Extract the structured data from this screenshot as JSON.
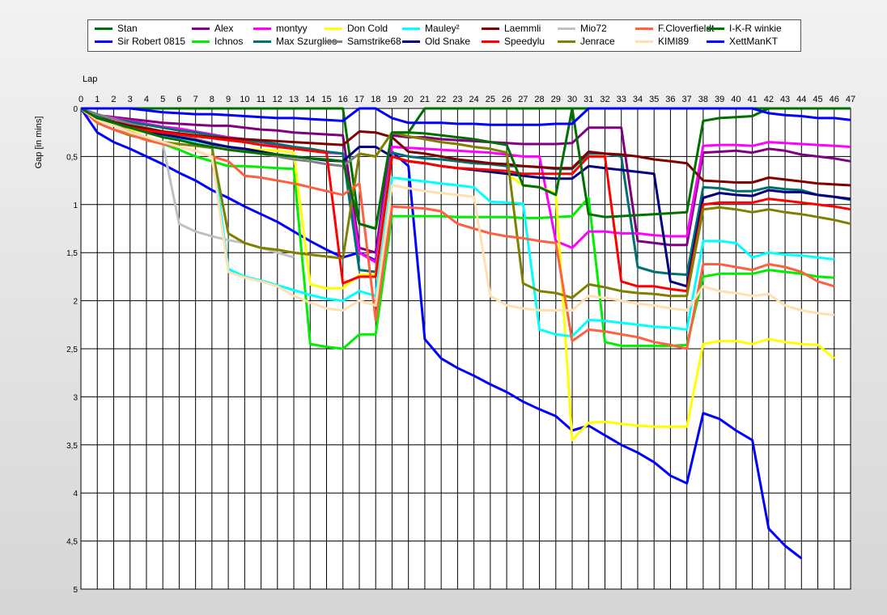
{
  "chart_data": {
    "type": "line",
    "xlabel": "Lap",
    "ylabel": "Gap [in mins]",
    "xlim": [
      0,
      47
    ],
    "ylim": [
      0,
      5
    ],
    "x_ticks": [
      0,
      1,
      2,
      3,
      4,
      5,
      6,
      7,
      8,
      9,
      10,
      11,
      12,
      13,
      14,
      15,
      16,
      17,
      18,
      19,
      20,
      21,
      22,
      23,
      24,
      25,
      26,
      27,
      28,
      29,
      30,
      31,
      32,
      33,
      34,
      35,
      36,
      37,
      38,
      39,
      40,
      41,
      42,
      43,
      44,
      45,
      46,
      47
    ],
    "y_ticks": [
      0,
      0.5,
      1,
      1.5,
      2,
      2.5,
      3,
      3.5,
      4,
      4.5,
      5
    ],
    "y_tick_labels": [
      "0",
      "0,5",
      "1",
      "1,5",
      "2",
      "2,5",
      "3",
      "3,5",
      "4",
      "4,5",
      "5"
    ],
    "grid": true,
    "legend_position": "top",
    "series": [
      {
        "name": "Stan",
        "color": "#007000",
        "values": [
          0,
          0,
          0,
          0,
          0,
          0,
          0,
          0,
          0,
          0,
          0,
          0,
          0,
          0,
          0,
          0,
          0,
          1.2,
          1.25,
          0.25,
          0.25,
          0,
          0,
          0,
          0,
          0,
          0,
          0,
          0,
          0,
          0,
          0,
          0,
          0,
          0,
          0,
          0,
          0,
          0,
          0,
          0,
          0,
          0,
          0,
          0,
          0,
          0,
          0
        ]
      },
      {
        "name": "Sir Robert 0815",
        "color": "#0000ff",
        "values": [
          0,
          0.25,
          0.35,
          0.42,
          0.5,
          0.58,
          0.67,
          0.75,
          0.85,
          0.93,
          1.02,
          1.1,
          1.18,
          1.28,
          1.38,
          1.47,
          1.55,
          1.5,
          1.58,
          0.45,
          0.6,
          2.4,
          2.6,
          2.7,
          2.78,
          2.87,
          2.95,
          3.05,
          3.13,
          3.2,
          3.35,
          3.3,
          3.4,
          3.5,
          3.58,
          3.68,
          3.82,
          3.9,
          3.17,
          3.23,
          3.35,
          3.45,
          4.37,
          4.55,
          4.68,
          null,
          null,
          null
        ]
      },
      {
        "name": "Alex",
        "color": "#800080",
        "values": [
          0,
          0.07,
          0.09,
          0.11,
          0.13,
          0.15,
          0.16,
          0.17,
          0.18,
          0.18,
          0.2,
          0.22,
          0.23,
          0.25,
          0.26,
          0.27,
          0.28,
          1.45,
          1.5,
          0.28,
          0.3,
          0.3,
          0.32,
          0.33,
          0.34,
          0.35,
          0.36,
          0.37,
          0.37,
          0.37,
          0.36,
          0.2,
          0.2,
          0.2,
          1.38,
          1.4,
          1.42,
          1.42,
          0.46,
          0.45,
          0.44,
          0.46,
          0.42,
          0.44,
          0.48,
          0.5,
          0.52,
          0.55
        ]
      },
      {
        "name": "Ichnos",
        "color": "#00ee00",
        "values": [
          0,
          0.1,
          0.18,
          0.25,
          0.32,
          0.37,
          0.43,
          0.5,
          0.55,
          0.6,
          0.6,
          0.61,
          0.62,
          0.63,
          2.45,
          2.48,
          2.5,
          2.35,
          2.35,
          1.12,
          1.12,
          1.12,
          1.12,
          1.13,
          1.13,
          1.13,
          1.13,
          1.14,
          1.14,
          1.13,
          1.12,
          0.93,
          2.43,
          2.47,
          2.47,
          2.47,
          2.47,
          2.46,
          1.75,
          1.72,
          1.72,
          1.72,
          1.68,
          1.7,
          1.72,
          1.75,
          1.76,
          null
        ]
      },
      {
        "name": "montyy",
        "color": "#ff00ff",
        "values": [
          0,
          0.07,
          0.1,
          0.13,
          0.16,
          0.19,
          0.21,
          0.24,
          0.27,
          0.3,
          0.32,
          0.35,
          0.38,
          0.41,
          0.44,
          0.46,
          0.47,
          1.5,
          1.6,
          0.4,
          0.41,
          0.42,
          0.43,
          0.44,
          0.45,
          0.46,
          0.48,
          0.5,
          0.5,
          1.38,
          1.45,
          1.28,
          1.28,
          1.3,
          1.3,
          1.32,
          1.33,
          1.33,
          0.39,
          0.38,
          0.38,
          0.39,
          0.35,
          0.36,
          0.37,
          0.38,
          0.39,
          0.4
        ]
      },
      {
        "name": "Max Szurglies",
        "color": "#007070",
        "values": [
          0,
          0.08,
          0.11,
          0.14,
          0.17,
          0.2,
          0.23,
          0.25,
          0.28,
          0.31,
          0.33,
          0.35,
          0.37,
          0.4,
          0.42,
          0.45,
          0.47,
          1.68,
          1.7,
          0.46,
          0.5,
          0.52,
          0.53,
          0.55,
          0.57,
          0.58,
          0.6,
          0.6,
          0.61,
          0.63,
          0.63,
          0.47,
          0.47,
          0.5,
          1.65,
          1.7,
          1.72,
          1.73,
          0.82,
          0.83,
          0.86,
          0.86,
          0.82,
          0.84,
          0.85,
          0.9,
          0.92,
          0.95
        ]
      },
      {
        "name": "Don Cold",
        "color": "#ffff00",
        "values": [
          0,
          0.12,
          0.18,
          0.22,
          0.25,
          0.28,
          0.31,
          0.34,
          0.37,
          0.4,
          0.42,
          0.43,
          0.44,
          0.46,
          1.83,
          1.87,
          1.87,
          1.73,
          1.73,
          0.5,
          0.55,
          0.57,
          0.6,
          0.62,
          0.64,
          0.66,
          0.68,
          0.8,
          0.82,
          0.88,
          3.45,
          3.27,
          3.26,
          3.28,
          3.3,
          3.31,
          3.31,
          3.31,
          2.45,
          2.42,
          2.42,
          2.45,
          2.4,
          2.43,
          2.45,
          2.46,
          2.6,
          null
        ]
      },
      {
        "name": "Samstrike68",
        "color": "#808080",
        "values": [
          0,
          0.06,
          0.11,
          0.16,
          0.2,
          0.24,
          0.28,
          0.32,
          0.36,
          0.4,
          0.44,
          0.47,
          0.5,
          0.53,
          0.55,
          0.58,
          0.6,
          0.47,
          0.5,
          null,
          null,
          null,
          null,
          null,
          null,
          null,
          null,
          null,
          null,
          null,
          null,
          null,
          null,
          null,
          null,
          null,
          null,
          null,
          null,
          null,
          null,
          null,
          null,
          null,
          null,
          null,
          null,
          null
        ]
      },
      {
        "name": "Mauley²",
        "color": "#00ffff",
        "values": [
          0,
          0.1,
          0.15,
          0.2,
          0.24,
          0.28,
          0.31,
          0.34,
          0.37,
          1.67,
          1.75,
          1.79,
          1.84,
          1.89,
          1.94,
          1.98,
          2.0,
          1.9,
          1.95,
          0.72,
          0.74,
          0.76,
          0.78,
          0.8,
          0.82,
          0.97,
          0.98,
          0.99,
          2.3,
          2.35,
          2.37,
          2.2,
          2.21,
          2.23,
          2.25,
          2.27,
          2.28,
          2.3,
          1.38,
          1.38,
          1.4,
          1.55,
          1.5,
          1.52,
          1.53,
          1.55,
          1.57,
          null
        ]
      },
      {
        "name": "Old Snake",
        "color": "#000080",
        "values": [
          0,
          0.1,
          0.16,
          0.2,
          0.24,
          0.27,
          0.3,
          0.33,
          0.37,
          0.4,
          0.42,
          0.45,
          0.48,
          0.5,
          0.52,
          0.54,
          0.55,
          0.4,
          0.4,
          0.5,
          0.55,
          0.57,
          0.6,
          0.62,
          0.64,
          0.66,
          0.68,
          0.7,
          0.72,
          0.73,
          0.73,
          0.6,
          0.62,
          0.64,
          0.66,
          0.68,
          1.8,
          1.85,
          0.93,
          0.88,
          0.9,
          0.91,
          0.85,
          0.87,
          0.87,
          0.9,
          0.92,
          0.94
        ]
      },
      {
        "name": "Laemmli",
        "color": "#800000",
        "values": [
          0,
          0.1,
          0.14,
          0.18,
          0.21,
          0.24,
          0.26,
          0.28,
          0.3,
          0.31,
          0.32,
          0.33,
          0.34,
          0.35,
          0.36,
          0.37,
          0.38,
          0.24,
          0.25,
          0.3,
          0.45,
          0.47,
          0.5,
          0.53,
          0.55,
          0.57,
          0.58,
          0.6,
          0.61,
          0.62,
          0.62,
          0.45,
          0.47,
          0.48,
          0.5,
          0.53,
          0.55,
          0.57,
          0.75,
          0.76,
          0.77,
          0.77,
          0.72,
          0.74,
          0.76,
          0.78,
          0.79,
          0.8
        ]
      },
      {
        "name": "Speedylu",
        "color": "#ff0000",
        "values": [
          0,
          0.12,
          0.16,
          0.2,
          0.23,
          0.25,
          0.27,
          0.29,
          0.31,
          0.33,
          0.35,
          0.38,
          0.4,
          0.42,
          0.44,
          0.46,
          1.82,
          1.75,
          1.75,
          0.5,
          0.55,
          0.57,
          0.6,
          0.62,
          0.63,
          0.64,
          0.65,
          0.68,
          0.68,
          0.68,
          0.68,
          0.5,
          0.5,
          1.8,
          1.85,
          1.85,
          1.88,
          1.9,
          1.0,
          0.98,
          0.98,
          0.98,
          0.94,
          0.96,
          0.98,
          1.0,
          1.02,
          1.05
        ]
      },
      {
        "name": "Mio72",
        "color": "#c0c0c0",
        "values": [
          0,
          0.1,
          0.17,
          0.24,
          0.3,
          0.37,
          1.2,
          1.28,
          1.33,
          1.37,
          1.4,
          1.45,
          1.5,
          1.55,
          null,
          null,
          null,
          null,
          null,
          null,
          null,
          null,
          null,
          null,
          null,
          null,
          null,
          null,
          null,
          null,
          null,
          null,
          null,
          null,
          null,
          null,
          null,
          null,
          null,
          null,
          null,
          null,
          null,
          null,
          null,
          null,
          null,
          null
        ]
      },
      {
        "name": "Jenrace",
        "color": "#808000",
        "values": [
          0,
          0.15,
          0.22,
          0.28,
          0.32,
          0.35,
          0.37,
          0.39,
          0.41,
          1.3,
          1.4,
          1.45,
          1.47,
          1.5,
          1.52,
          1.54,
          1.56,
          0.47,
          0.5,
          0.25,
          0.29,
          0.32,
          0.35,
          0.37,
          0.4,
          0.42,
          0.46,
          1.82,
          1.9,
          1.92,
          1.97,
          1.83,
          1.86,
          1.9,
          1.92,
          1.93,
          1.95,
          1.95,
          1.05,
          1.03,
          1.05,
          1.08,
          1.05,
          1.08,
          1.1,
          1.13,
          1.16,
          1.2
        ]
      },
      {
        "name": "F.Cloverfieldt",
        "color": "#ff6040",
        "values": [
          0,
          0.15,
          0.22,
          0.27,
          0.33,
          0.37,
          0.4,
          0.44,
          0.5,
          0.55,
          0.7,
          0.72,
          0.75,
          0.78,
          0.82,
          0.86,
          0.9,
          0.78,
          2.2,
          1.02,
          1.03,
          1.04,
          1.07,
          1.2,
          1.25,
          1.3,
          1.33,
          1.35,
          1.38,
          1.4,
          2.42,
          2.3,
          2.32,
          2.35,
          2.38,
          2.43,
          2.46,
          2.5,
          1.62,
          1.62,
          1.65,
          1.68,
          1.62,
          1.65,
          1.7,
          1.8,
          1.85,
          null
        ]
      },
      {
        "name": "KIMI89",
        "color": "#ffe0b0",
        "values": [
          0,
          0.12,
          0.18,
          0.25,
          0.3,
          0.35,
          0.4,
          0.44,
          0.5,
          1.7,
          1.76,
          1.8,
          1.85,
          1.95,
          2.02,
          2.08,
          2.1,
          2.0,
          2.05,
          0.8,
          0.83,
          0.86,
          0.88,
          0.9,
          0.92,
          1.95,
          2.05,
          2.08,
          2.1,
          2.1,
          2.1,
          1.95,
          1.97,
          2.0,
          2.03,
          2.05,
          2.08,
          2.1,
          1.85,
          1.9,
          1.92,
          1.95,
          1.93,
          2.05,
          2.1,
          2.13,
          2.15,
          null
        ]
      },
      {
        "name": "I-K-R winkie",
        "color": "#007000",
        "values": [
          0,
          0.1,
          0.15,
          0.2,
          0.25,
          0.3,
          0.33,
          0.37,
          0.4,
          0.43,
          0.45,
          0.47,
          0.48,
          0.5,
          0.52,
          0.53,
          0.55,
          1.2,
          1.25,
          0.25,
          0.25,
          0.26,
          0.28,
          0.3,
          0.32,
          0.35,
          0.38,
          0.8,
          0.82,
          0.9,
          0.0,
          1.1,
          1.13,
          1.12,
          1.11,
          1.1,
          1.09,
          1.08,
          0.13,
          0.1,
          0.09,
          0.08,
          0.0,
          0.0,
          0.0,
          0.0,
          0.0,
          0.0
        ]
      },
      {
        "name": "XettManKT",
        "color": "#0000ff",
        "values": [
          0,
          0.0,
          0.0,
          0.0,
          0.02,
          0.04,
          0.05,
          0.06,
          0.06,
          0.07,
          0.08,
          0.09,
          0.1,
          0.1,
          0.11,
          0.12,
          0.13,
          0.0,
          0.0,
          0.1,
          0.15,
          0.15,
          0.15,
          0.16,
          0.16,
          0.17,
          0.17,
          0.17,
          0.17,
          0.16,
          0.16,
          0.0,
          0.0,
          0.0,
          0.0,
          0.0,
          0.0,
          0.0,
          0.0,
          0.0,
          0.0,
          0.0,
          0.05,
          0.07,
          0.08,
          0.1,
          0.1,
          0.12
        ]
      }
    ]
  }
}
